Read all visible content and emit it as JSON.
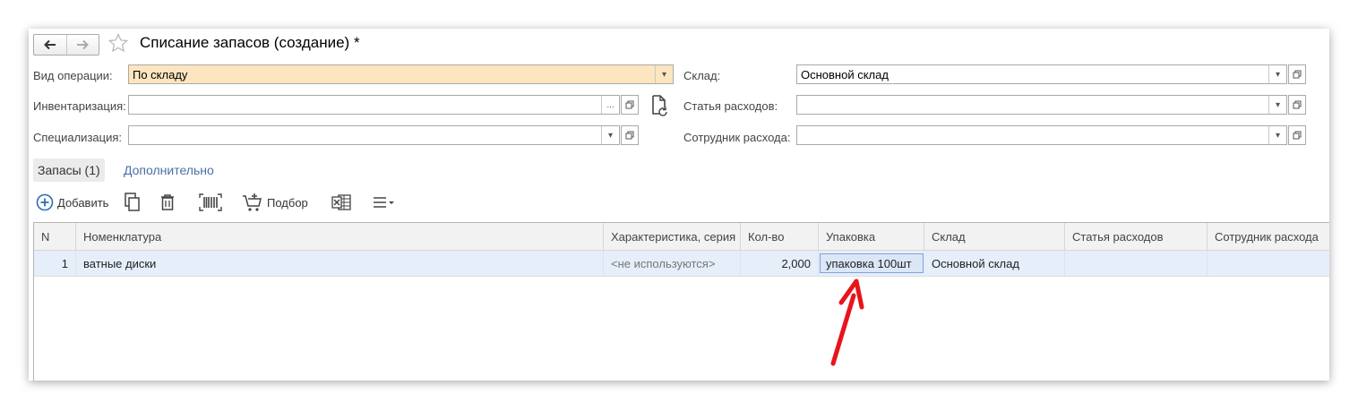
{
  "window": {
    "title": "Списание запасов (создание) *"
  },
  "form": {
    "operation_type": {
      "label": "Вид операции:",
      "value": "По складу"
    },
    "inventory": {
      "label": "Инвентаризация:",
      "value": "",
      "choose_label": "..."
    },
    "specialization": {
      "label": "Специализация:",
      "value": ""
    },
    "warehouse": {
      "label": "Склад:",
      "value": "Основной склад"
    },
    "expense_item": {
      "label": "Статья расходов:",
      "value": ""
    },
    "expense_employee": {
      "label": "Сотрудник расхода:",
      "value": ""
    }
  },
  "tabs": [
    {
      "label": "Запасы (1)",
      "active": true
    },
    {
      "label": "Дополнительно",
      "active": false
    }
  ],
  "toolbar": {
    "add_label": "Добавить",
    "pick_label": "Подбор"
  },
  "table": {
    "headers": {
      "n": "N",
      "nomenclature": "Номенклатура",
      "characteristic": "Характеристика, серия",
      "qty": "Кол-во",
      "package": "Упаковка",
      "warehouse": "Склад",
      "expense_item": "Статья расходов",
      "employee": "Сотрудник расхода"
    },
    "rows": [
      {
        "n": "1",
        "nomenclature": "ватные диски",
        "characteristic": "<не используются>",
        "qty": "2,000",
        "package": "упаковка 100шт",
        "warehouse": "Основной склад",
        "expense_item": "",
        "employee": ""
      }
    ]
  },
  "colors": {
    "highlight_field": "#fde5c0",
    "selected_row": "#e6eefa",
    "link": "#4a6fa5",
    "annotation_arrow": "#e8141c"
  }
}
